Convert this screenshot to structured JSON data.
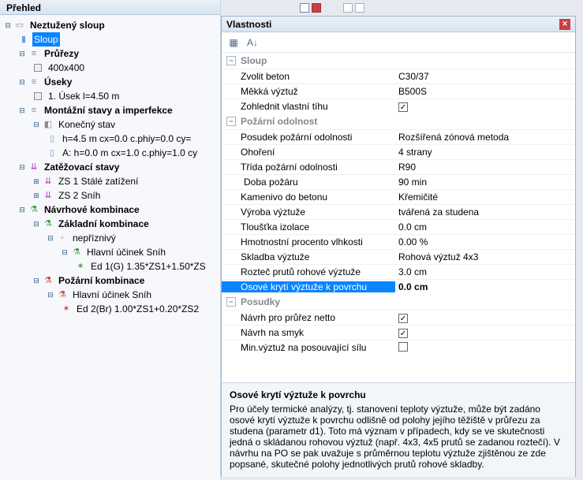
{
  "left": {
    "title": "Přehled",
    "root": "Neztužený sloup",
    "sloup": "Sloup",
    "prurezy": "Průřezy",
    "prurez1": "400x400",
    "useky": "Úseky",
    "usek1": "1. Úsek  l=4.50 m",
    "montazni": "Montážní stavy a imperfekce",
    "konecny": "Konečný stav",
    "kon1": "h=4.5 m  cx=0.0 c.phiy=0.0 cy=",
    "kon2": "A: h=0.0 m  cx=1.0 c.phiy=1.0 cy",
    "zatezovaci": "Zatěžovací stavy",
    "zs1": "ZS 1 Stálé zatížení",
    "zs2": "ZS 2 Sníh",
    "navrhove": "Návrhové kombinace",
    "zakladni": "Základní kombinace",
    "nepriznivy": "nepříznivý",
    "hlavni1": "Hlavní účinek Sníh",
    "ed1": "Ed 1(G)  1.35*ZS1+1.50*ZS",
    "pozarni": "Požární kombinace",
    "hlavni2": "Hlavní účinek Sníh",
    "ed2": "Ed 2(Br)  1.00*ZS1+0.20*ZS2"
  },
  "right": {
    "title": "Vlastnosti",
    "cat1": "Sloup",
    "p_zvolit": "Zvolit beton",
    "v_zvolit": "C30/37",
    "p_mekka": "Měkká výztuž",
    "v_mekka": "B500S",
    "p_zohlednit": "Zohlednit vlastní tíhu",
    "cat2": "Požární odolnost",
    "p_posudek": "Posudek požární odolnosti",
    "v_posudek": "Rozšířená zónová metoda",
    "p_ohoreni": "Ohoření",
    "v_ohoreni": "4 strany",
    "p_trida": "Třída požární odolnosti",
    "v_trida": "R90",
    "p_doba": "Doba požáru",
    "v_doba": "90 min",
    "p_kamenivo": "Kamenivo do betonu",
    "v_kamenivo": "Křemičité",
    "p_vyroba": "Výroba výztuže",
    "v_vyroba": "tvářená za studena",
    "p_tloustka": "Tloušťka izolace",
    "v_tloustka": "0.0 cm",
    "p_hmot": "Hmotnostní procento vlhkosti",
    "v_hmot": "0.00 %",
    "p_skladba": "Skladba výztuže",
    "v_skladba": "Rohová výztuž 4x3",
    "p_roztec": "Rozteč prutů rohové výztuže",
    "v_roztec": "3.0 cm",
    "p_osove": "Osové krytí výztuže k povrchu",
    "v_osove": "0.0 cm",
    "cat3": "Posudky",
    "p_navrhp": "Návrh pro průřez netto",
    "p_navrhs": "Návrh na smyk",
    "p_minv": "Min.výztuž na posouvající sílu",
    "desc_title": "Osové krytí výztuže k povrchu",
    "desc_body": "Pro účely termické analýzy, tj. stanovení teploty výztuže, může být zadáno osové krytí výztuže k povrchu odlišně od polohy jejího těžiště v průřezu za studena (parametr d1). Toto má význam v případech, kdy se ve skutečnosti jedná o skládanou rohovou výztuž (např. 4x3, 4x5 prutů se zadanou roztečí). V návrhu na PO se pak uvažuje s průměrnou teplotu výztuže zjištěnou ze zde popsané, skutečné polohy jednotlivých prutů rohové skladby."
  }
}
